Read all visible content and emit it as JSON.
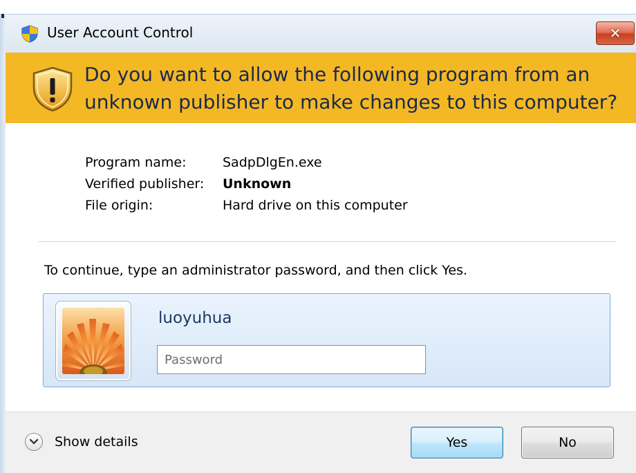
{
  "window": {
    "title": "User Account Control",
    "close_label": "✕"
  },
  "banner": {
    "question": "Do you want to allow the following program from an unknown publisher to make changes to this computer?",
    "color": "#f4b825"
  },
  "program_info": {
    "rows": [
      {
        "label": "Program name:",
        "value": "SadpDlgEn.exe"
      },
      {
        "label": "Verified publisher:",
        "value": "Unknown"
      },
      {
        "label": "File origin:",
        "value": "Hard drive on this computer"
      }
    ]
  },
  "instruction": "To continue, type an administrator password, and then click Yes.",
  "credential": {
    "user_name": "luoyuhua",
    "password_placeholder": "Password",
    "password_value": "",
    "avatar_icon": "flower-avatar-icon"
  },
  "footer": {
    "details_label": "Show details",
    "yes_label": "Yes",
    "no_label": "No"
  }
}
